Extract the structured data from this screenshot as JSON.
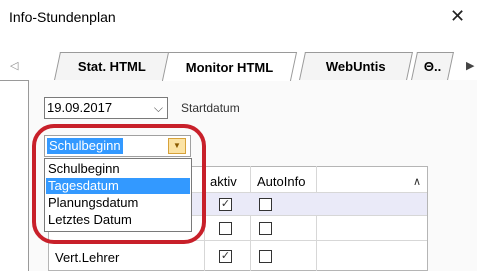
{
  "window": {
    "title": "Info-Stundenplan"
  },
  "tabs": [
    {
      "label": "Stat. HTML"
    },
    {
      "label": "Monitor HTML"
    },
    {
      "label": "WebUntis"
    },
    {
      "label": "Θ.."
    }
  ],
  "date_field": {
    "value": "19.09.2017",
    "label": "Startdatum"
  },
  "mode_combo": {
    "selected": "Schulbeginn",
    "options": [
      "Schulbeginn",
      "Tagesdatum",
      "Planungsdatum",
      "Letztes Datum"
    ],
    "highlighted": "Tagesdatum"
  },
  "grid": {
    "columns": [
      "aktiv",
      "AutoInfo"
    ],
    "rows": [
      {
        "label": "",
        "aktiv": true,
        "autoinfo": false
      },
      {
        "label": "",
        "aktiv": false,
        "autoinfo": false
      },
      {
        "label": "Vert.Lehrer",
        "aktiv": true,
        "autoinfo": false
      }
    ]
  },
  "colors": {
    "selection": "#3399ff",
    "highlight_ring": "#c8202a"
  }
}
